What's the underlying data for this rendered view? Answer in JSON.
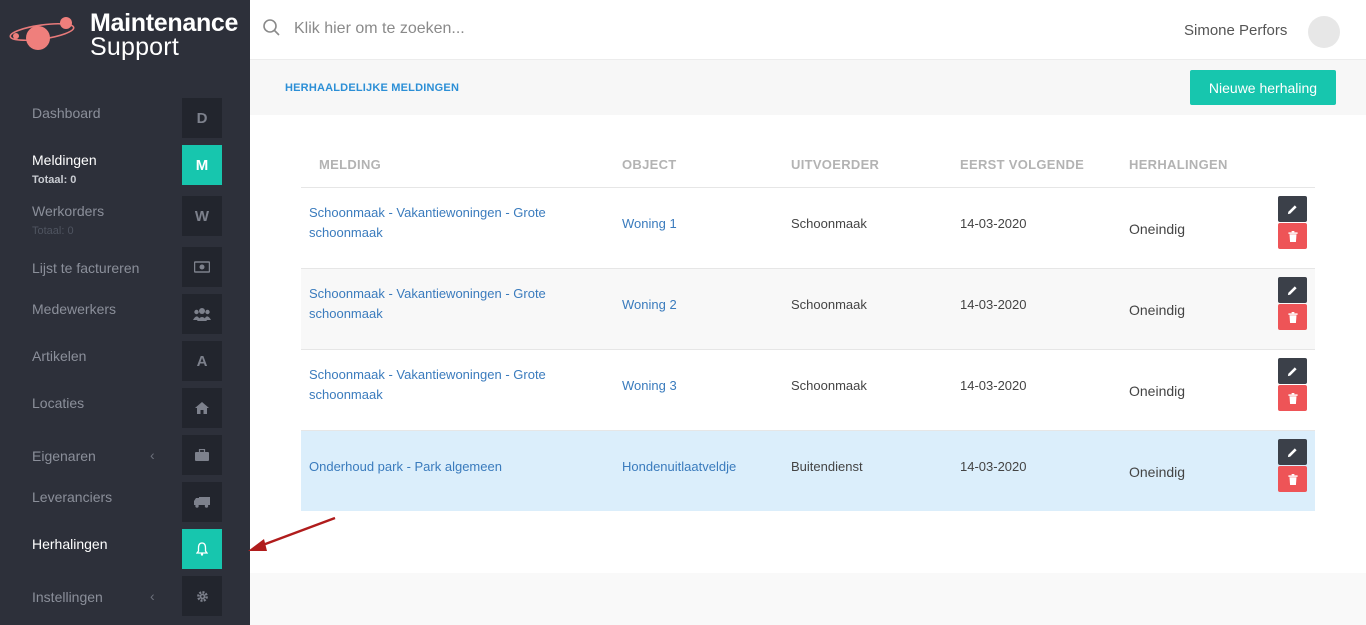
{
  "logo": {
    "line1": "Maintenance",
    "line2": "Support"
  },
  "sidebar": {
    "items": [
      {
        "label": "Dashboard",
        "box": "D"
      },
      {
        "label": "Meldingen",
        "sub": "Totaal: 0",
        "box": "M"
      },
      {
        "label": "Werkorders",
        "sub": "Totaal: 0",
        "box": "W"
      },
      {
        "label": "Lijst te factureren",
        "icon": "money-icon"
      },
      {
        "label": "Medewerkers",
        "icon": "users-icon"
      },
      {
        "label": "Artikelen",
        "box": "A"
      },
      {
        "label": "Locaties",
        "icon": "home-icon"
      },
      {
        "label": "Eigenaren",
        "chevron": "‹",
        "icon": "briefcase-icon"
      },
      {
        "label": "Leveranciers",
        "icon": "truck-icon"
      },
      {
        "label": "Herhalingen",
        "icon": "bell-icon"
      },
      {
        "label": "Instellingen",
        "chevron": "‹",
        "icon": "gear-icon"
      }
    ]
  },
  "search": {
    "placeholder": "Klik hier om te zoeken..."
  },
  "user": {
    "name": "Simone Perfors"
  },
  "page": {
    "title": "HERHAALDELIJKE MELDINGEN",
    "new_button": "Nieuwe herhaling"
  },
  "table": {
    "headers": [
      "MELDING",
      "OBJECT",
      "UITVOERDER",
      "EERST VOLGENDE",
      "HERHALINGEN"
    ],
    "rows": [
      {
        "melding_1": "Schoonmaak - Vakantiewoningen - Grote",
        "melding_2": "schoonmaak",
        "object": "Woning 1",
        "uitvoerder": "Schoonmaak",
        "datum": "14-03-2020",
        "herhalingen": "Oneindig"
      },
      {
        "melding_1": "Schoonmaak - Vakantiewoningen - Grote",
        "melding_2": "schoonmaak",
        "object": "Woning 2",
        "uitvoerder": "Schoonmaak",
        "datum": "14-03-2020",
        "herhalingen": "Oneindig"
      },
      {
        "melding_1": "Schoonmaak - Vakantiewoningen - Grote",
        "melding_2": "schoonmaak",
        "object": "Woning 3",
        "uitvoerder": "Schoonmaak",
        "datum": "14-03-2020",
        "herhalingen": "Oneindig"
      },
      {
        "melding_1": "Onderhoud park - Park algemeen",
        "melding_2": "",
        "object": "Hondenuitlaatveldje",
        "uitvoerder": "Buitendienst",
        "datum": "14-03-2020",
        "herhalingen": "Oneindig"
      }
    ]
  },
  "colors": {
    "accent": "#17c6ae",
    "sidebar": "#2d303a",
    "link": "#3a7bbd",
    "delete": "#ee5457",
    "annotation_arrow": "#b01c1c"
  }
}
